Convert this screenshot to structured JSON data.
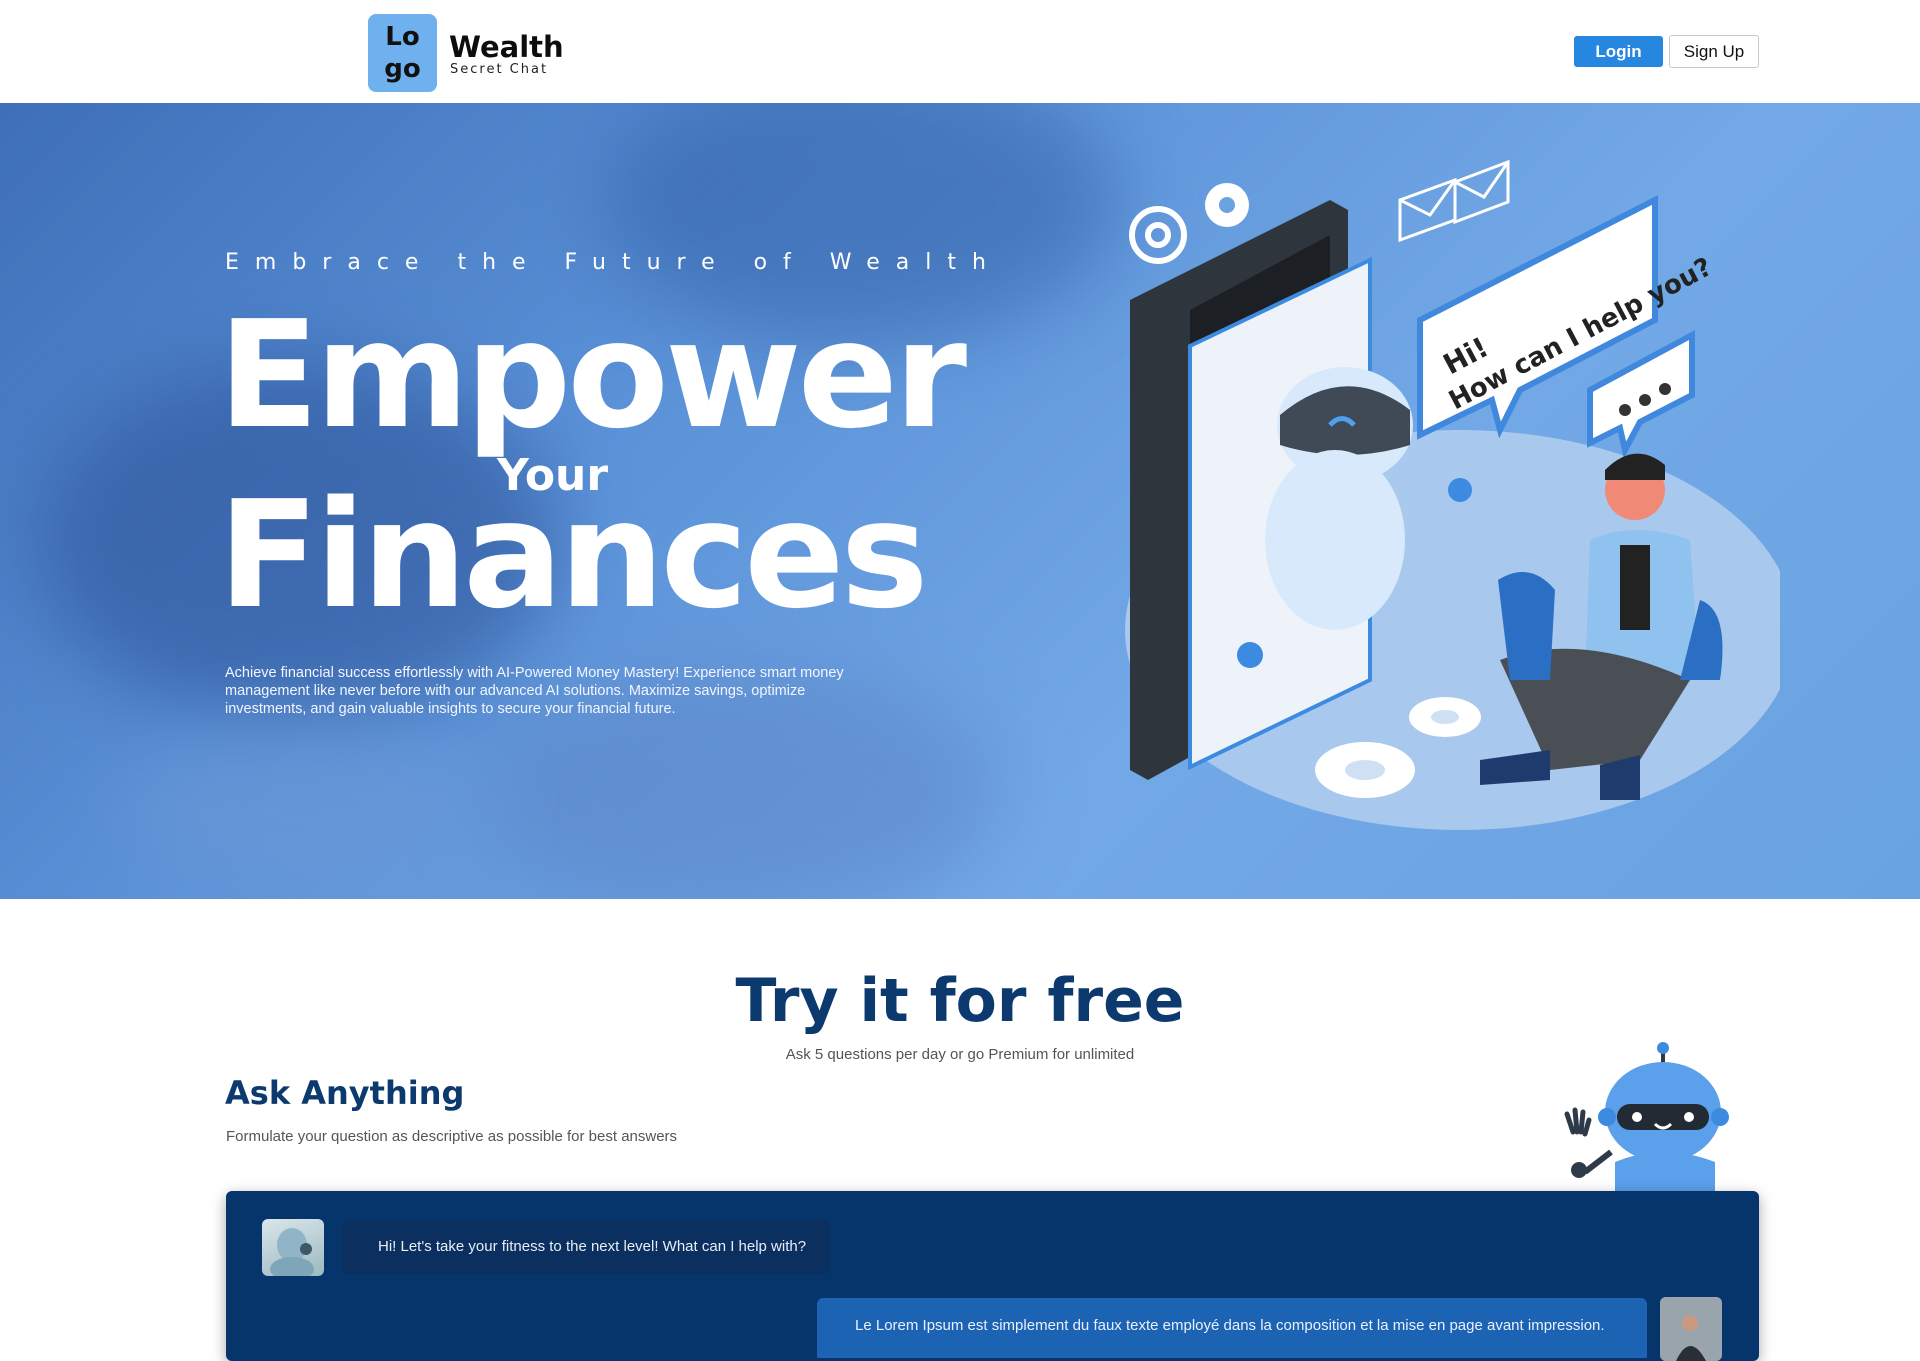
{
  "header": {
    "logo_line1": "Lo",
    "logo_line2": "go",
    "brand_name": "Wealth",
    "brand_tagline": "Secret Chat",
    "login_label": "Login",
    "signup_label": "Sign Up"
  },
  "hero": {
    "eyebrow": "Embrace the Future of Wealth",
    "headline_1": "Empower",
    "headline_2": "Your",
    "headline_3": "Finances",
    "description": "Achieve financial success effortlessly with AI-Powered Money Mastery! Experience smart money management like never before with our advanced AI solutions. Maximize savings, optimize investments, and gain valuable insights to secure your financial future.",
    "speech_line1": "Hi!",
    "speech_line2": "How can I help you?"
  },
  "try_section": {
    "title": "Try it for free",
    "subtitle": "Ask 5 questions per day or go Premium for unlimited"
  },
  "ask_section": {
    "title": "Ask Anything",
    "subtitle": "Formulate your question as descriptive as possible for best answers"
  },
  "chat": {
    "messages": [
      {
        "from": "bot",
        "text": "Hi! Let's take your fitness to the next level! What can I help with?"
      },
      {
        "from": "user",
        "text": "Le Lorem Ipsum est simplement du faux texte employé dans la composition et la mise en page avant impression."
      }
    ]
  },
  "colors": {
    "primary": "#2687e0",
    "navy": "#0c3a6e",
    "chat_bg": "#06356b",
    "hero_blue": "#5b92d8"
  }
}
